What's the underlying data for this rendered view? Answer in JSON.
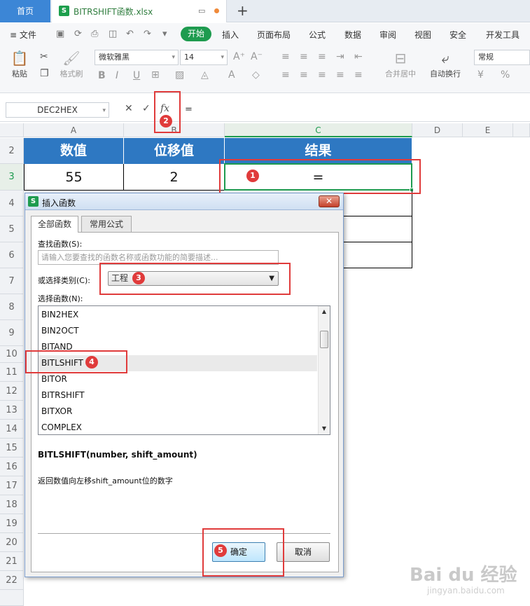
{
  "titlebar": {
    "home_tab": "首页",
    "file_icon": "S",
    "file_name": "BITRSHIFT函数.xlsx",
    "new_tab": "+"
  },
  "menubar": {
    "file_menu": "≡ 文件",
    "start": "开始",
    "items": [
      "插入",
      "页面布局",
      "公式",
      "数据",
      "审阅",
      "视图",
      "安全",
      "开发工具"
    ]
  },
  "ribbon": {
    "paste": "粘贴",
    "format_painter": "格式刷",
    "font_name": "微软雅黑",
    "font_size": "14",
    "merge_center": "合并居中",
    "wrap_text": "自动换行",
    "number_format": "常规"
  },
  "formula_bar": {
    "name_box": "DEC2HEX",
    "formula": "=",
    "fx_label": "fx"
  },
  "grid": {
    "columns": [
      "A",
      "B",
      "C",
      "D",
      "E"
    ],
    "rows": [
      "2",
      "3",
      "4",
      "5",
      "6",
      "7",
      "8",
      "9",
      "10",
      "11",
      "12",
      "13",
      "14",
      "15",
      "16",
      "17",
      "18",
      "19",
      "20",
      "21",
      "22"
    ],
    "headers": [
      "数值",
      "位移值",
      "结果"
    ],
    "row3": [
      "55",
      "2",
      "="
    ]
  },
  "annotations": [
    "1",
    "2",
    "3",
    "4",
    "5"
  ],
  "dialog": {
    "title_icon": "S",
    "title": "插入函数",
    "close": "✕",
    "tabs": [
      "全部函数",
      "常用公式"
    ],
    "search_label": "查找函数(S):",
    "search_placeholder": "请输入您要查找的函数名称或函数功能的简要描述...",
    "category_label": "或选择类别(C):",
    "category_value": "工程",
    "list_label": "选择函数(N):",
    "functions": [
      "BIN2HEX",
      "BIN2OCT",
      "BITAND",
      "BITLSHIFT",
      "BITOR",
      "BITRSHIFT",
      "BITXOR",
      "COMPLEX"
    ],
    "selected_function": "BITLSHIFT",
    "signature": "BITLSHIFT(number, shift_amount)",
    "description": "返回数值向左移shift_amount位的数字",
    "ok": "确定",
    "cancel": "取消"
  },
  "watermark": {
    "brand": "Bai du 经验",
    "url": "jingyan.baidu.com"
  },
  "colors": {
    "accent_green": "#1e9b4f",
    "header_blue": "#2e78c2",
    "annotation_red": "#e03b3b"
  }
}
